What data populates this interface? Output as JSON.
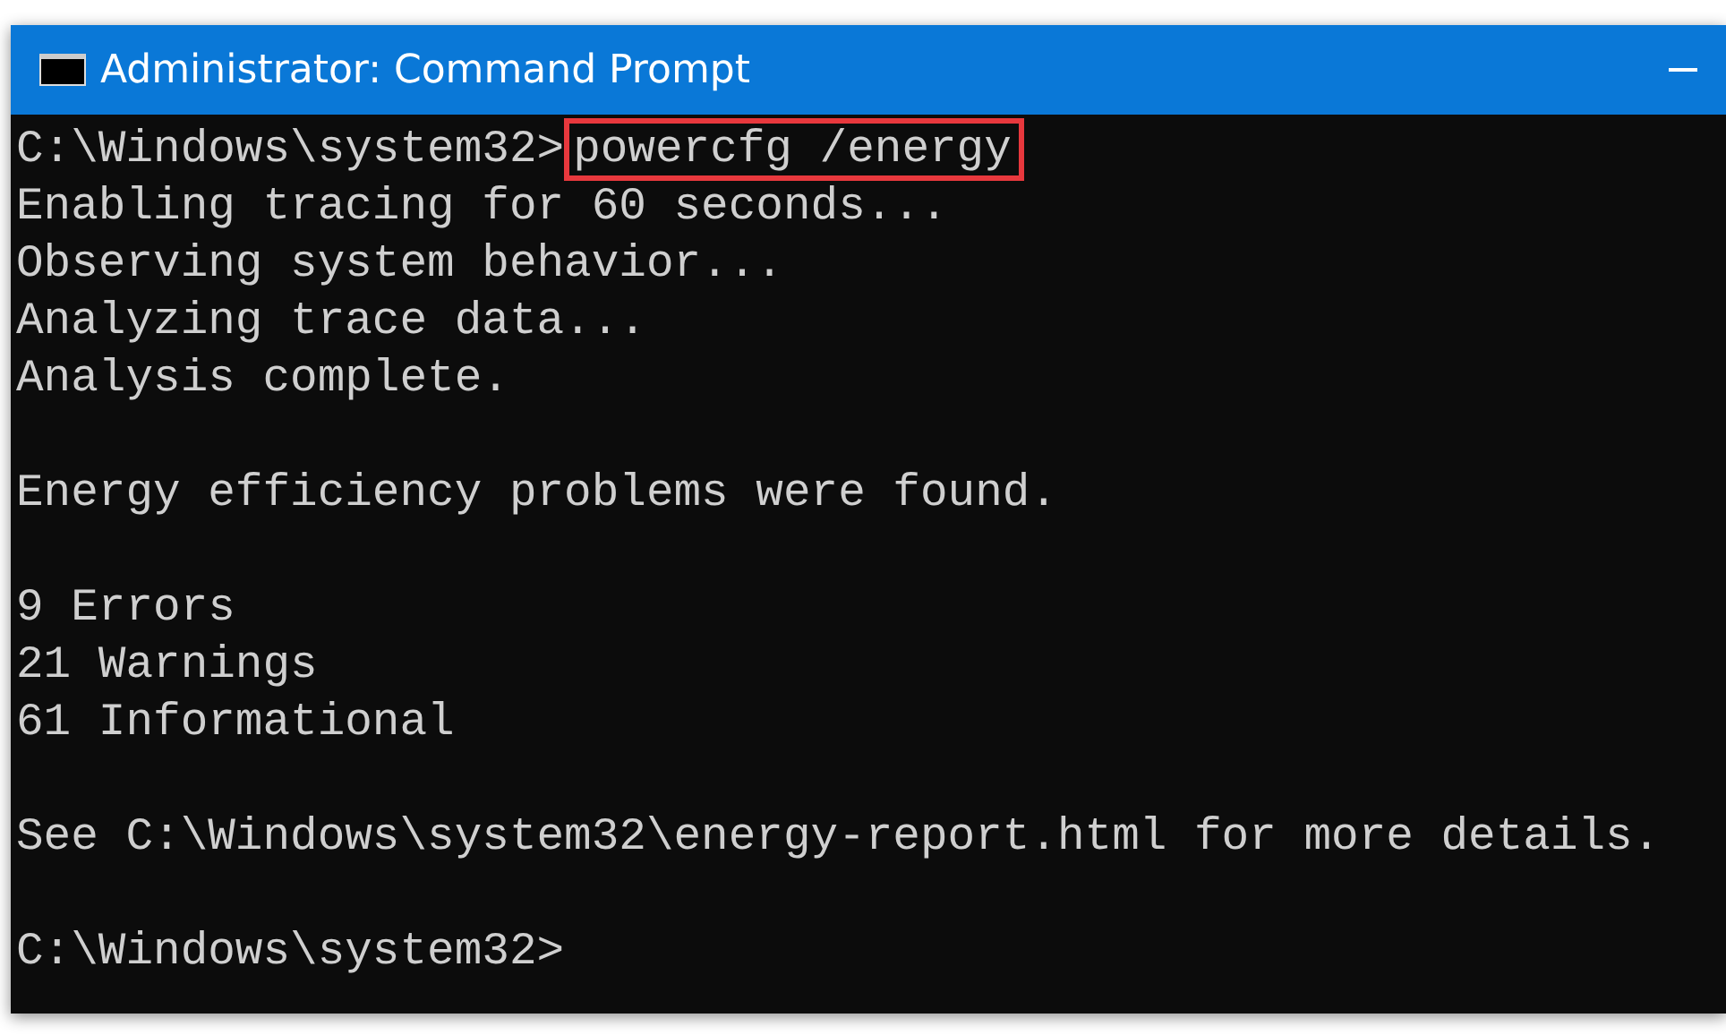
{
  "window": {
    "title": "Administrator: Command Prompt"
  },
  "console": {
    "lines": [
      {
        "kind": "command",
        "prompt": "C:\\Windows\\system32>",
        "command": "powercfg /energy",
        "highlighted": true
      },
      {
        "kind": "output",
        "text": "Enabling tracing for 60 seconds..."
      },
      {
        "kind": "output",
        "text": "Observing system behavior..."
      },
      {
        "kind": "output",
        "text": "Analyzing trace data..."
      },
      {
        "kind": "output",
        "text": "Analysis complete."
      },
      {
        "kind": "blank"
      },
      {
        "kind": "output",
        "text": "Energy efficiency problems were found."
      },
      {
        "kind": "blank"
      },
      {
        "kind": "output",
        "text": "9 Errors"
      },
      {
        "kind": "output",
        "text": "21 Warnings"
      },
      {
        "kind": "output",
        "text": "61 Informational"
      },
      {
        "kind": "blank"
      },
      {
        "kind": "output",
        "text": "See C:\\Windows\\system32\\energy-report.html for more details."
      },
      {
        "kind": "blank"
      },
      {
        "kind": "command",
        "prompt": "C:\\Windows\\system32>"
      }
    ]
  }
}
